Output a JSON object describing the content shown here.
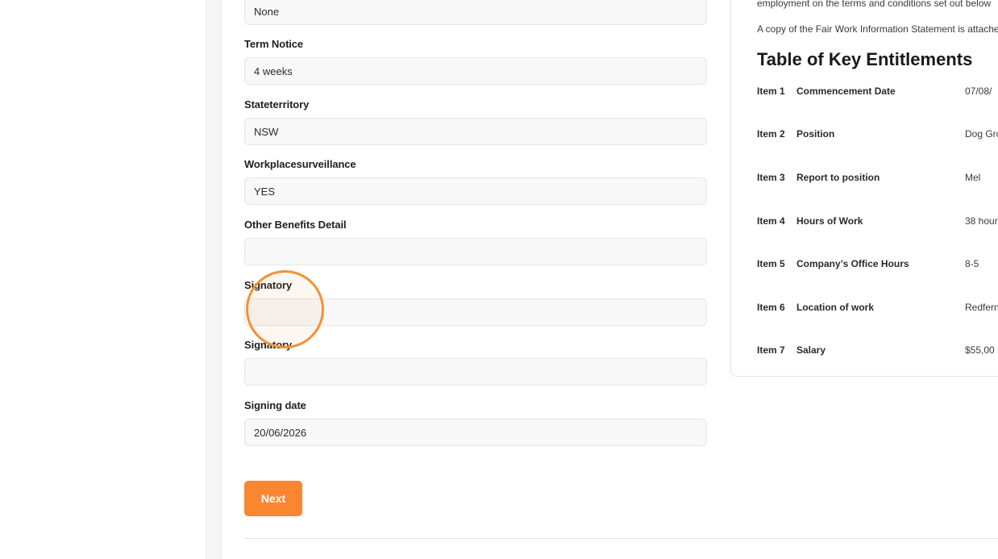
{
  "form": {
    "fields": [
      {
        "label": "",
        "value": "None"
      },
      {
        "label": "Term Notice",
        "value": "4 weeks"
      },
      {
        "label": "Stateterritory",
        "value": "NSW"
      },
      {
        "label": "Workplacesurveillance",
        "value": "YES"
      },
      {
        "label": "Other Benefits Detail",
        "value": ""
      },
      {
        "label": "Signatory",
        "value": ""
      },
      {
        "label": "Signatory",
        "value": ""
      },
      {
        "label": "Signing date",
        "value": "20/06/2026"
      }
    ],
    "next_label": "Next"
  },
  "document": {
    "intro_line": "employment on the terms and conditions set out below",
    "fair_work_line": "A copy of the Fair Work Information Statement is attached",
    "table_title": "Table of Key Entitlements",
    "entitlements": [
      {
        "item": "Item 1",
        "label": "Commencement Date",
        "value": "07/08/"
      },
      {
        "item": "Item 2",
        "label": "Position",
        "value": "Dog Gro"
      },
      {
        "item": "Item 3",
        "label": "Report to position",
        "value": "Mel"
      },
      {
        "item": "Item 4",
        "label": "Hours of Work",
        "value": "38 hour"
      },
      {
        "item": "Item 5",
        "label": "Company’s Office Hours",
        "value": "8-5"
      },
      {
        "item": "Item 6",
        "label": "Location of work",
        "value": "Redfern"
      },
      {
        "item": "Item 7",
        "label": "Salary",
        "value": "$55,00"
      }
    ]
  },
  "colors": {
    "accent": "#fb8632",
    "cursor_ring": "#f29235"
  }
}
